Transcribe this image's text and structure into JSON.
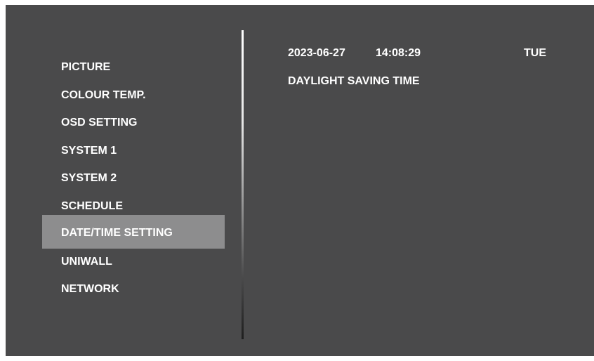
{
  "menu": {
    "items": [
      {
        "label": "PICTURE"
      },
      {
        "label": "COLOUR TEMP."
      },
      {
        "label": "OSD SETTING"
      },
      {
        "label": "SYSTEM 1"
      },
      {
        "label": "SYSTEM 2"
      },
      {
        "label": "SCHEDULE"
      },
      {
        "label": "DATE/TIME SETTING",
        "selected": true
      },
      {
        "label": "UNIWALL"
      },
      {
        "label": "NETWORK"
      }
    ]
  },
  "datetime": {
    "date": "2023-06-27",
    "time": "14:08:29",
    "weekday": "TUE",
    "option_label": "DAYLIGHT SAVING TIME"
  },
  "colors": {
    "background": "#4a4a4b",
    "highlight": "#8d8d8e",
    "text": "#ffffff"
  }
}
